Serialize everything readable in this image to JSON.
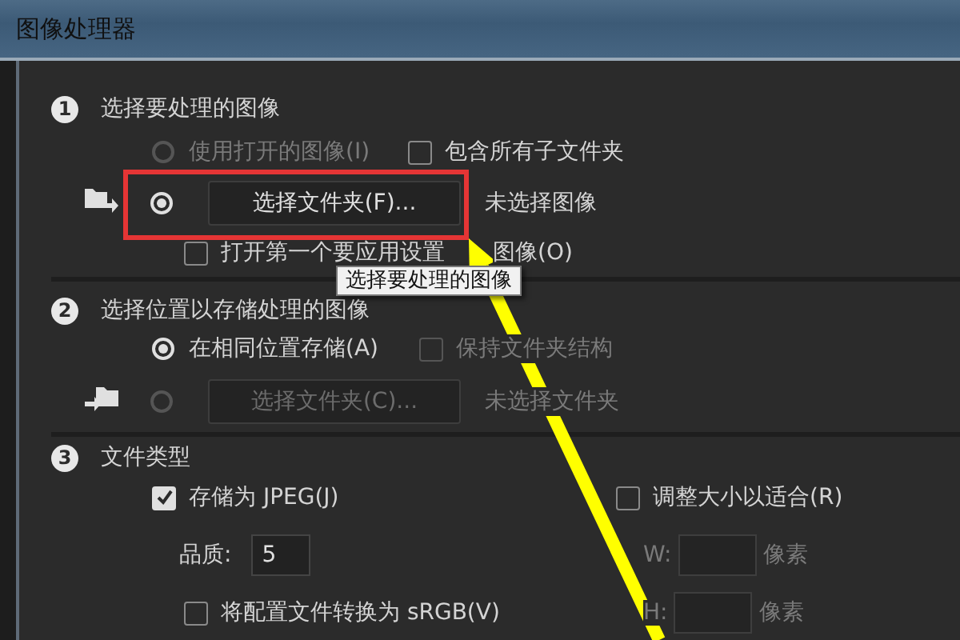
{
  "window": {
    "title": "图像处理器"
  },
  "source": {
    "number": "1",
    "title": "选择要处理的图像",
    "use_open": {
      "label": "使用打开的图像(I)",
      "selected": false,
      "disabled": true
    },
    "include_subfolders": {
      "label": "包含所有子文件夹",
      "checked": false
    },
    "select_folder": {
      "selected": true,
      "button": "选择文件夹(F)...",
      "status": "未选择图像"
    },
    "open_first": {
      "label": "打开第一个要应用设置",
      "label_continued": "图像(O)",
      "checked": false
    }
  },
  "destination": {
    "number": "2",
    "title": "选择位置以存储处理的图像",
    "same_location": {
      "label": "在相同位置存储(A)",
      "selected": true
    },
    "keep_structure": {
      "label": "保持文件夹结构",
      "checked": false,
      "disabled": true
    },
    "select_folder": {
      "selected": false,
      "disabled": true,
      "button": "选择文件夹(C)...",
      "status": "未选择文件夹"
    }
  },
  "file_type": {
    "number": "3",
    "title": "文件类型",
    "save_jpeg": {
      "label": "存储为 JPEG(J)",
      "checked": true
    },
    "quality": {
      "label": "品质:",
      "value": "5"
    },
    "convert_srgb": {
      "label": "将配置文件转换为 sRGB(V)",
      "checked": false
    },
    "resize": {
      "label": "调整大小以适合(R)",
      "checked": false
    },
    "width": {
      "label": "W:",
      "unit": "像素",
      "disabled": true
    },
    "height": {
      "label": "H:",
      "unit": "像素",
      "disabled": true
    }
  },
  "tooltip": {
    "text": "选择要处理的图像"
  }
}
